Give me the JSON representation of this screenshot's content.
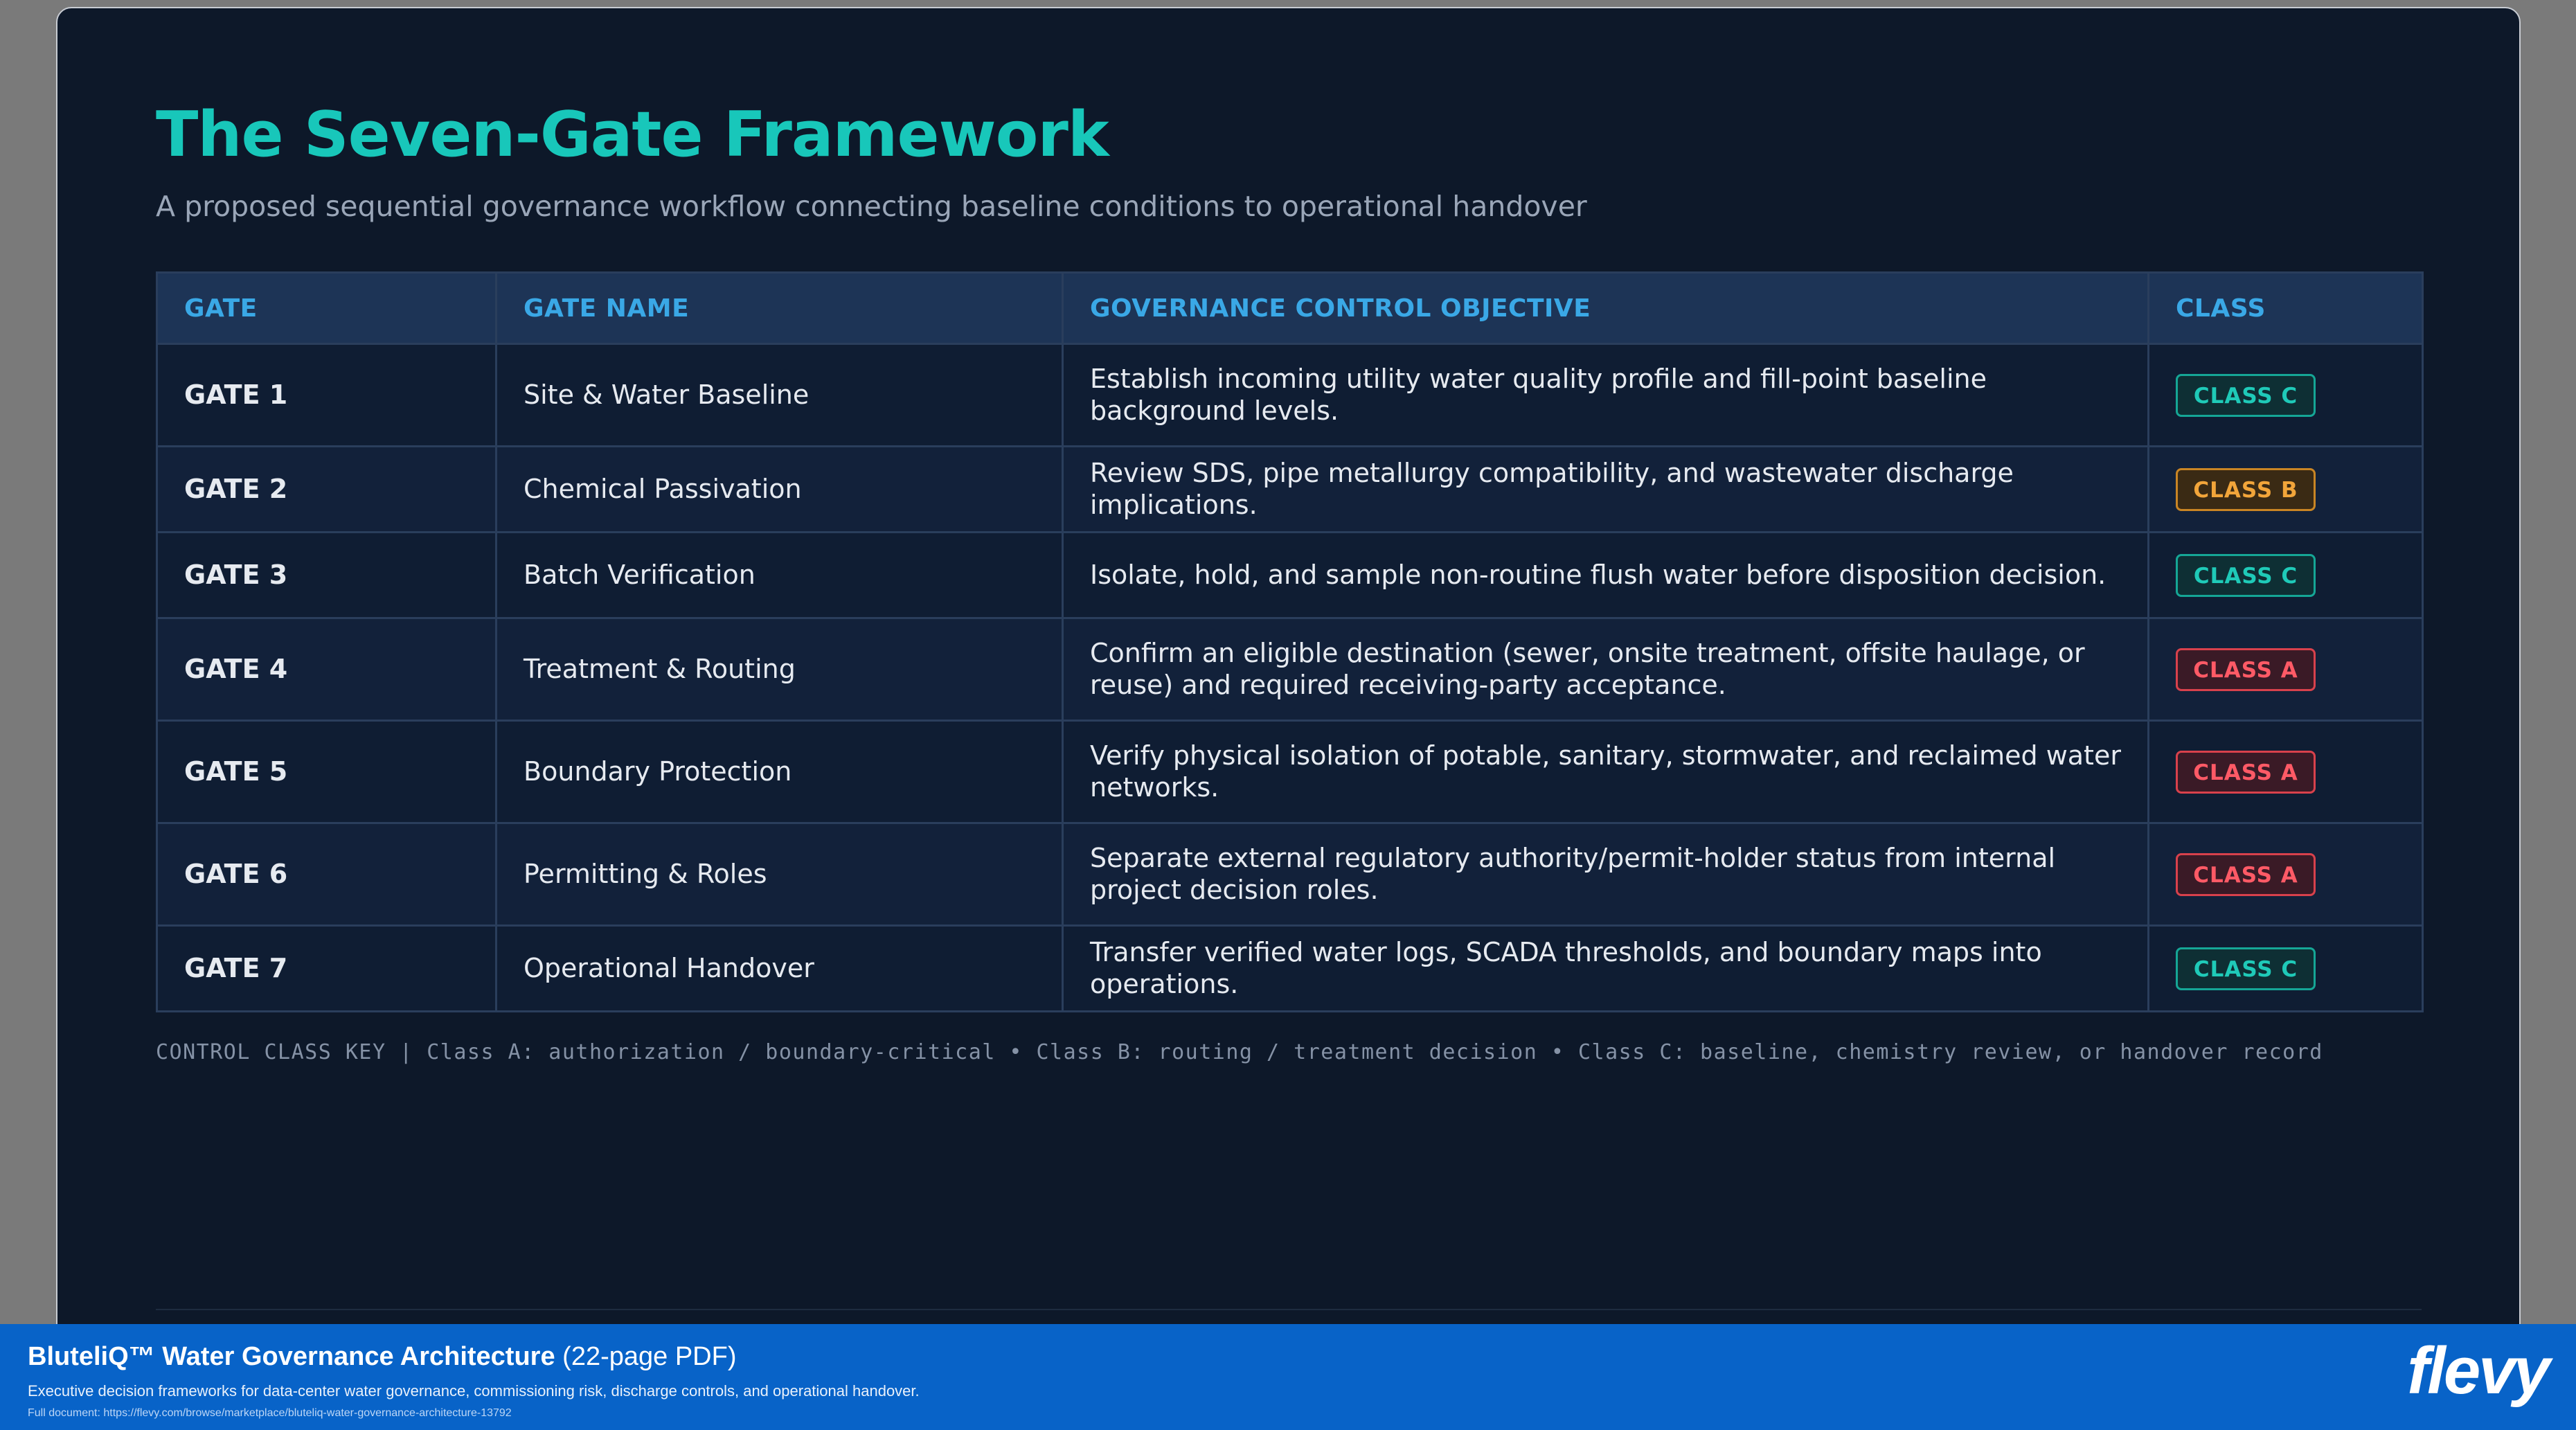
{
  "header": {
    "title": "The Seven-Gate Framework",
    "subtitle": "A proposed sequential governance workflow connecting baseline conditions to operational handover"
  },
  "table": {
    "columns": [
      "GATE",
      "GATE NAME",
      "GOVERNANCE CONTROL OBJECTIVE",
      "CLASS"
    ],
    "rows": [
      {
        "gate": "GATE 1",
        "name": "Site & Water Baseline",
        "objective": "Establish incoming utility water quality profile and fill-point baseline background levels.",
        "class": "CLASS C"
      },
      {
        "gate": "GATE 2",
        "name": "Chemical Passivation",
        "objective": "Review SDS, pipe metallurgy compatibility, and wastewater discharge implications.",
        "class": "CLASS B"
      },
      {
        "gate": "GATE 3",
        "name": "Batch Verification",
        "objective": "Isolate, hold, and sample non-routine flush water before disposition decision.",
        "class": "CLASS C"
      },
      {
        "gate": "GATE 4",
        "name": "Treatment & Routing",
        "objective": "Confirm an eligible destination (sewer, onsite treatment, offsite haulage, or reuse) and required receiving-party acceptance.",
        "class": "CLASS A"
      },
      {
        "gate": "GATE 5",
        "name": "Boundary Protection",
        "objective": "Verify physical isolation of potable, sanitary, stormwater, and reclaimed water networks.",
        "class": "CLASS A"
      },
      {
        "gate": "GATE 6",
        "name": "Permitting & Roles",
        "objective": "Separate external regulatory authority/permit-holder status from internal project decision roles.",
        "class": "CLASS A"
      },
      {
        "gate": "GATE 7",
        "name": "Operational Handover",
        "objective": "Transfer verified water logs, SCADA thresholds, and boundary maps into operations.",
        "class": "CLASS C"
      }
    ]
  },
  "class_colors": {
    "CLASS A": "#ff5a66",
    "CLASS B": "#f2a53a",
    "CLASS C": "#1fcab8"
  },
  "key": "CONTROL CLASS KEY | Class A: authorization / boundary-critical • Class B: routing / treatment decision • Class C: baseline, chemistry review, or handover record",
  "banner": {
    "title_strong": "BluteliQ™ Water Governance Architecture",
    "title_suffix": " (22-page PDF)",
    "description": "Executive decision frameworks for data-center water governance, commissioning risk, discharge controls, and operational handover.",
    "link": "Full document: https://flevy.com/browse/marketplace/bluteliq-water-governance-architecture-13792",
    "logo": "flevy"
  }
}
